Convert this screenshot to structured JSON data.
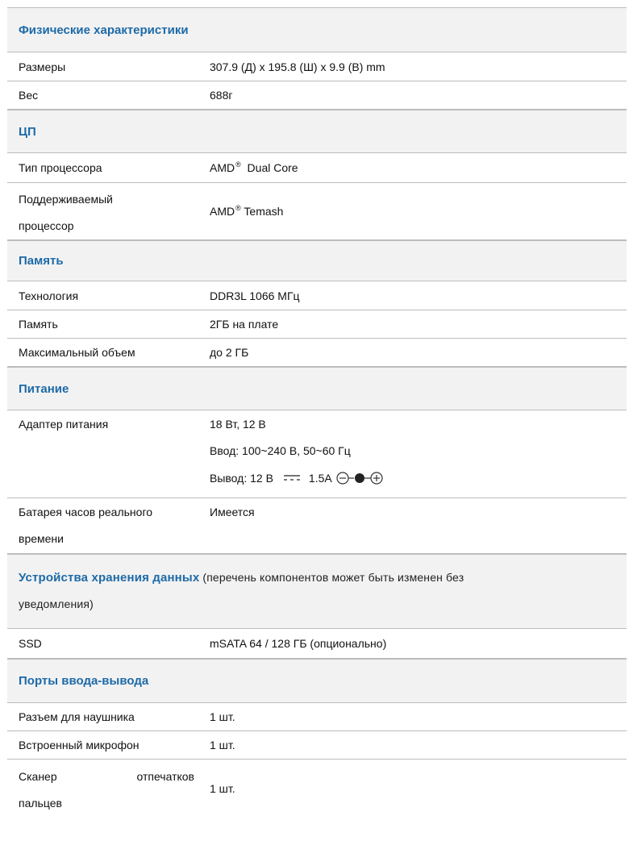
{
  "physical": {
    "title": "Физические характеристики",
    "rows": [
      {
        "label": "Размеры",
        "value": "307.9 (Д) x 195.8 (Ш) x 9.9 (В) mm"
      },
      {
        "label": "Вес",
        "value": "688г"
      }
    ]
  },
  "cpu": {
    "title": "ЦП",
    "type_label": "Тип процессора",
    "type_brand": "AMD",
    "type_reg": "®",
    "type_model": "Dual Core",
    "supported_label_1": "Поддерживаемый",
    "supported_label_2": "процессор",
    "supported_brand": "AMD",
    "supported_reg": "®",
    "supported_model": "Temash"
  },
  "memory": {
    "title": "Память",
    "rows": [
      {
        "label": "Технология",
        "value": "DDR3L 1066 МГц"
      },
      {
        "label": "Память",
        "value": "2ГБ на плате"
      },
      {
        "label": "Максимальный объем",
        "value": "до 2 ГБ"
      }
    ]
  },
  "power": {
    "title": "Питание",
    "adapter_label": "Адаптер питания",
    "adapter_line1": "18 Вт, 12 В",
    "adapter_line2": "Ввод: 100~240 В, 50~60 Гц",
    "adapter_line3_prefix": "Вывод: 12 В",
    "adapter_line3_current": "1.5A",
    "rtc_label_1": "Батарея часов реального",
    "rtc_label_2": "времени",
    "rtc_value": "Имеется"
  },
  "storage": {
    "title": "Устройства хранения данных",
    "note_line1": " (перечень компонентов может быть изменен без",
    "note_line2": "уведомления)",
    "rows": [
      {
        "label": "SSD",
        "value": "mSATA 64 / 128 ГБ (опционально)"
      }
    ]
  },
  "io": {
    "title": "Порты ввода-вывода",
    "rows": [
      {
        "label": "Разъем для наушника",
        "value": "1 шт."
      },
      {
        "label": "Встроенный микрофон",
        "value": "1 шт."
      }
    ],
    "scanner_label_w1": "Сканер",
    "scanner_label_w2": "отпечатков",
    "scanner_label_2": "пальцев",
    "scanner_value": "1 шт."
  }
}
